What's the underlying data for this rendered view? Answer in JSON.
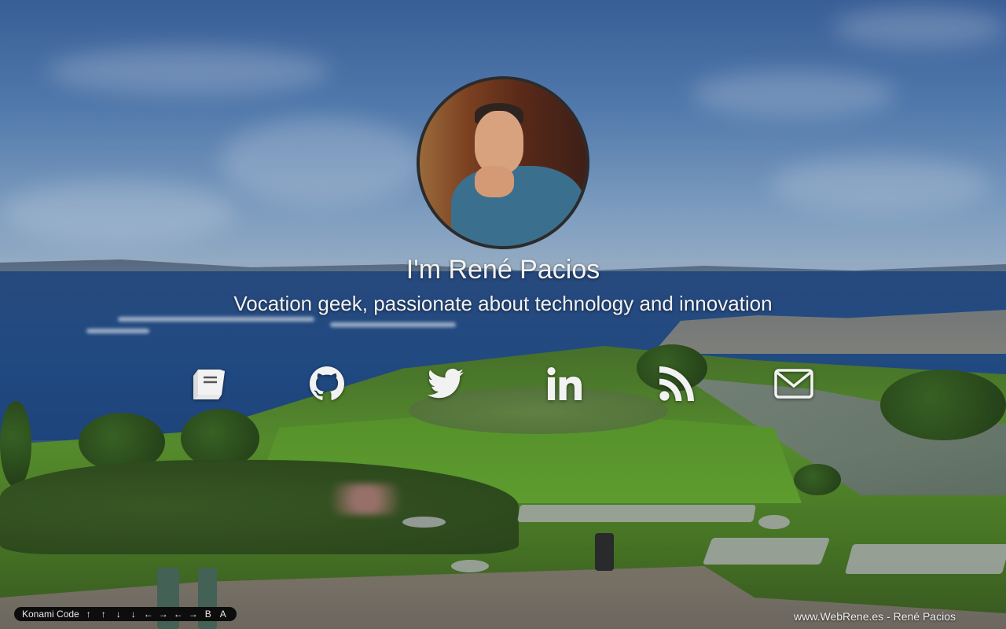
{
  "profile": {
    "title": "I'm René Pacios",
    "subtitle": "Vocation geek, passionate about technology and innovation"
  },
  "social_links": [
    {
      "name": "book-icon",
      "label": "Blog"
    },
    {
      "name": "github-icon",
      "label": "GitHub"
    },
    {
      "name": "twitter-icon",
      "label": "Twitter"
    },
    {
      "name": "linkedin-icon",
      "label": "LinkedIn"
    },
    {
      "name": "rss-icon",
      "label": "RSS"
    },
    {
      "name": "envelope-icon",
      "label": "Email"
    }
  ],
  "konami": {
    "label": "Konami Code",
    "keys": [
      "↑",
      "↑",
      "↓",
      "↓",
      "←",
      "→",
      "←",
      "→",
      "B",
      "A"
    ]
  },
  "footer": {
    "text": "www.WebRene.es - René Pacios"
  },
  "colors": {
    "text": "#f3f3f3",
    "badge_bg": "#0d0d0d",
    "avatar_border": "#2b2b2b"
  }
}
